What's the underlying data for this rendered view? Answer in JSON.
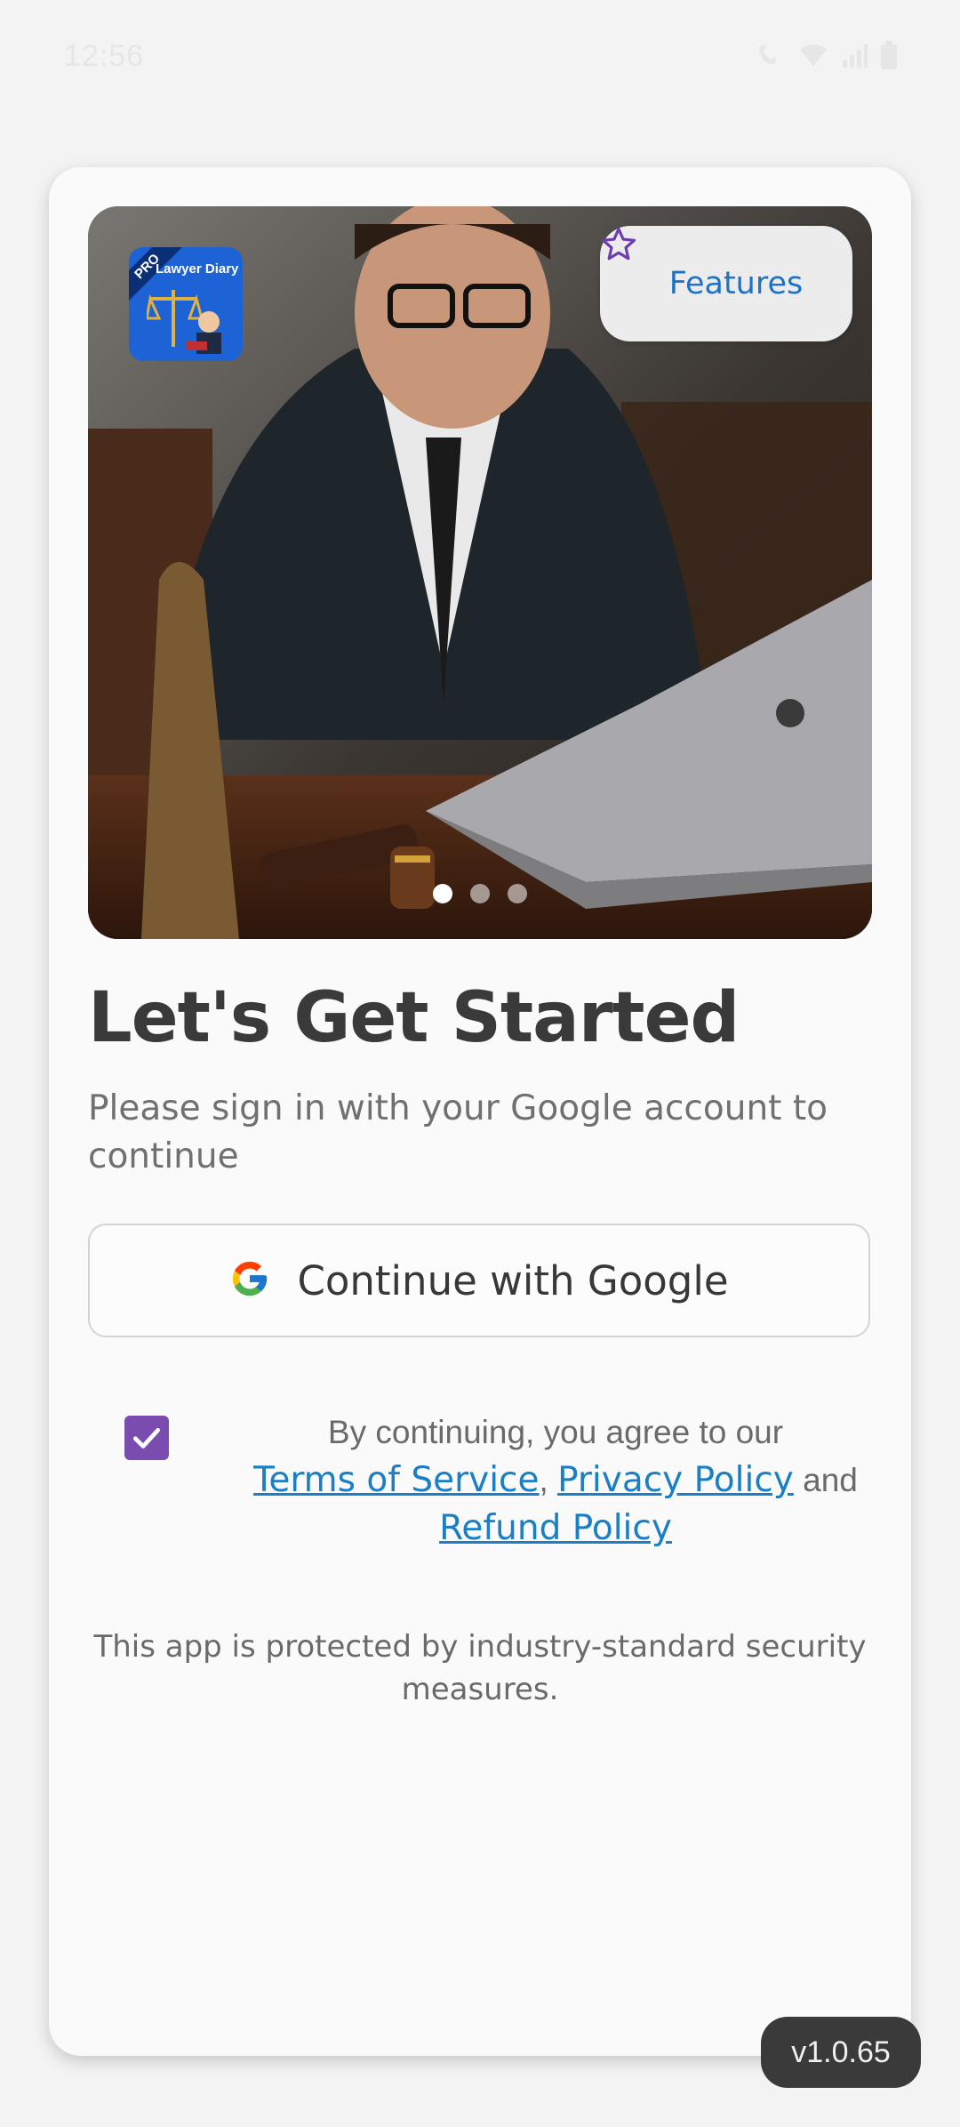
{
  "status_bar": {
    "time": "12:56"
  },
  "hero": {
    "app_logo": {
      "ribbon": "PRO",
      "title": "Lawyer Diary"
    },
    "features_label": "Features",
    "carousel": {
      "page_count": 3,
      "active_index": 0
    }
  },
  "signin": {
    "title": "Let's Get Started",
    "subtitle": "Please sign in with your Google account to continue",
    "google_button_label": "Continue with Google",
    "agreement": {
      "checked": true,
      "prefix": "By continuing, you agree to our",
      "terms_label": "Terms of Service",
      "separator": ",",
      "privacy_label": "Privacy Policy",
      "and_label": "and",
      "refund_label": "Refund Policy"
    },
    "security_note": "This app is protected by industry-standard security measures."
  },
  "version_label": "v1.0.65",
  "colors": {
    "accent_purple": "#7a4cb0",
    "link_blue": "#1a7fc4",
    "features_blue": "#1a73c8"
  }
}
